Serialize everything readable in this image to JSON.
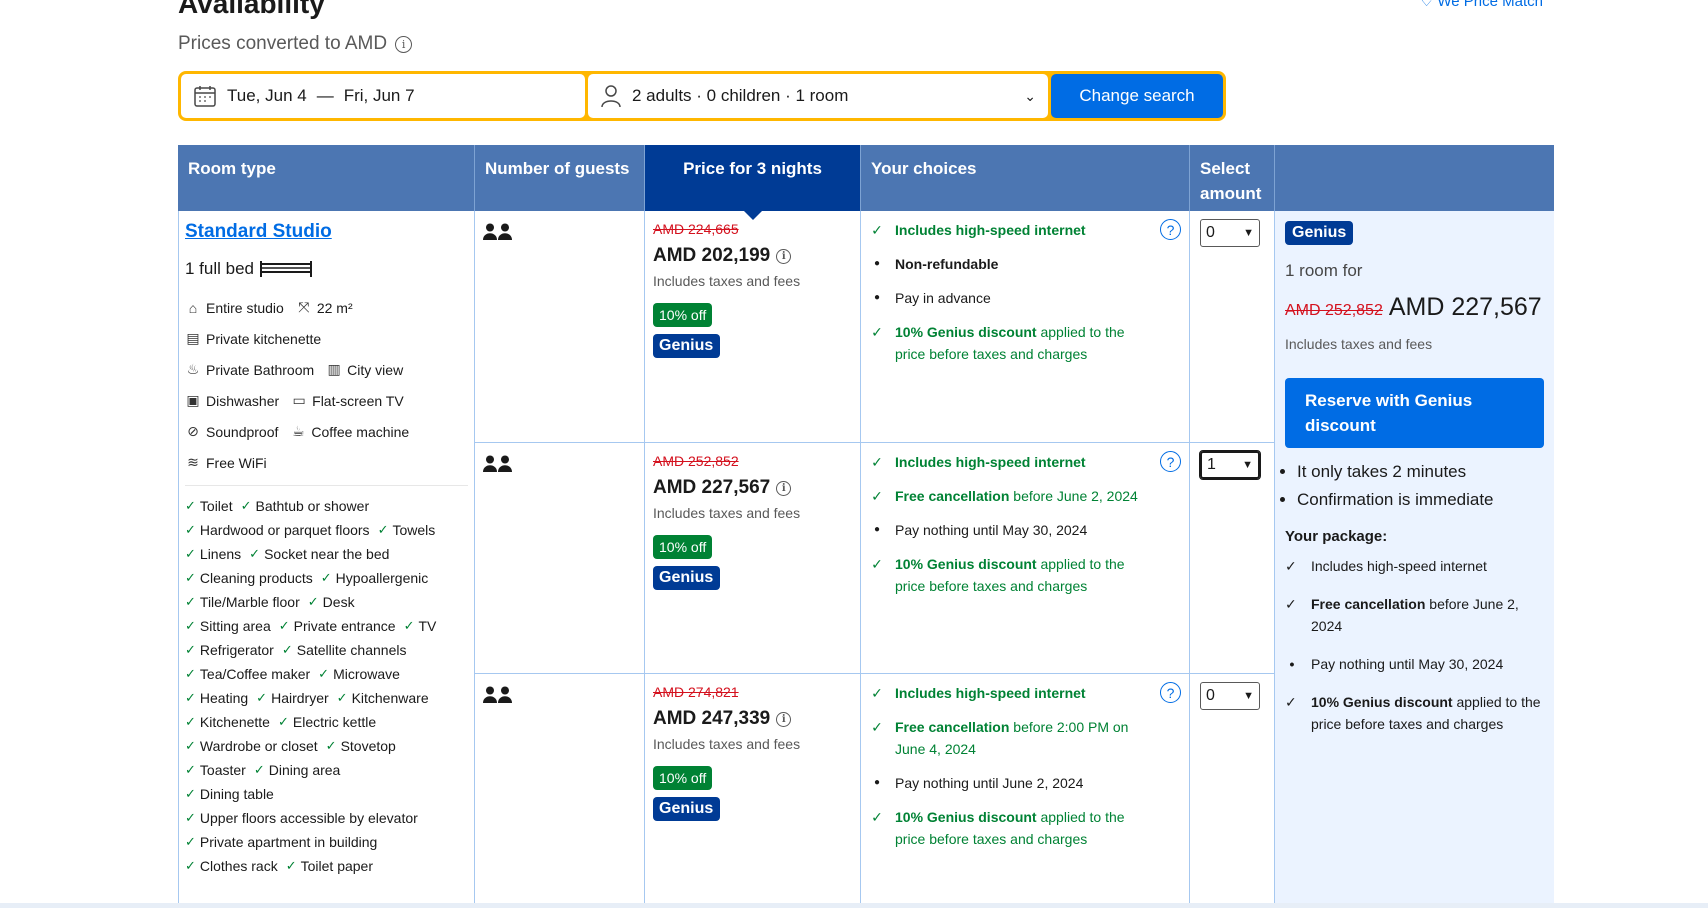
{
  "header": {
    "title": "Availability",
    "subtitle": "Prices converted to AMD",
    "price_match": "We Price Match"
  },
  "search": {
    "date_from": "Tue, Jun 4",
    "date_sep": "—",
    "date_to": "Fri, Jun 7",
    "guests": "2 adults · 0 children · 1 room",
    "button": "Change search"
  },
  "table_headers": {
    "room_type": "Room type",
    "guests": "Number of guests",
    "price": "Price for 3 nights",
    "choices": "Your choices",
    "select_1": "Select",
    "select_2": "amount"
  },
  "room": {
    "name": "Standard Studio",
    "bed": "1 full bed",
    "facilities": [
      [
        "Entire studio",
        "22 m²"
      ],
      [
        "Private kitchenette"
      ],
      [
        "Private Bathroom",
        "City view"
      ],
      [
        "Dishwasher",
        "Flat-screen TV"
      ],
      [
        "Soundproof",
        "Coffee machine"
      ],
      [
        "Free WiFi"
      ]
    ],
    "amenities": [
      [
        "Toilet",
        "Bathtub or shower"
      ],
      [
        "Hardwood or parquet floors",
        "Towels"
      ],
      [
        "Linens",
        "Socket near the bed"
      ],
      [
        "Cleaning products",
        "Hypoallergenic"
      ],
      [
        "Tile/Marble floor",
        "Desk"
      ],
      [
        "Sitting area",
        "Private entrance",
        "TV"
      ],
      [
        "Refrigerator",
        "Satellite channels"
      ],
      [
        "Tea/Coffee maker",
        "Microwave"
      ],
      [
        "Heating",
        "Hairdryer",
        "Kitchenware"
      ],
      [
        "Kitchenette",
        "Electric kettle"
      ],
      [
        "Wardrobe or closet",
        "Stovetop"
      ],
      [
        "Toaster",
        "Dining area"
      ],
      [
        "Dining table"
      ],
      [
        "Upper floors accessible by elevator"
      ],
      [
        "Private apartment in building"
      ],
      [
        "Clothes rack",
        "Toilet paper"
      ]
    ]
  },
  "options": [
    {
      "old_price": "AMD 224,665",
      "price": "AMD 202,199",
      "taxes": "Includes taxes and fees",
      "discount": "10% off",
      "genius": "Genius",
      "choices": [
        {
          "mark": "check",
          "bold": "Includes high-speed internet",
          "rest": "",
          "style": "green"
        },
        {
          "mark": "dot",
          "bold": "Non-refundable",
          "rest": "",
          "style": "dark"
        },
        {
          "mark": "dot",
          "bold": "",
          "rest": "Pay in advance",
          "style": "dark"
        },
        {
          "mark": "check",
          "bold": "10% Genius discount",
          "rest": " applied to the price before taxes and charges",
          "style": "green"
        }
      ],
      "select_value": "0"
    },
    {
      "old_price": "AMD 252,852",
      "price": "AMD 227,567",
      "taxes": "Includes taxes and fees",
      "discount": "10% off",
      "genius": "Genius",
      "choices": [
        {
          "mark": "check",
          "bold": "Includes high-speed internet",
          "rest": "",
          "style": "green"
        },
        {
          "mark": "check",
          "bold": "Free cancellation",
          "rest": " before June 2, 2024",
          "style": "green"
        },
        {
          "mark": "dot",
          "bold": "",
          "rest": "Pay nothing until May 30, 2024",
          "style": "dark"
        },
        {
          "mark": "check",
          "bold": "10% Genius discount",
          "rest": " applied to the price before taxes and charges",
          "style": "green"
        }
      ],
      "select_value": "1"
    },
    {
      "old_price": "AMD 274,821",
      "price": "AMD 247,339",
      "taxes": "Includes taxes and fees",
      "discount": "10% off",
      "genius": "Genius",
      "choices": [
        {
          "mark": "check",
          "bold": "Includes high-speed internet",
          "rest": "",
          "style": "green"
        },
        {
          "mark": "check",
          "bold": "Free cancellation",
          "rest": " before 2:00 PM on June 4, 2024",
          "style": "green"
        },
        {
          "mark": "dot",
          "bold": "",
          "rest": "Pay nothing until June 2, 2024",
          "style": "dark"
        },
        {
          "mark": "check",
          "bold": "10% Genius discount",
          "rest": " applied to the price before taxes and charges",
          "style": "green"
        }
      ],
      "select_value": "0"
    }
  ],
  "summary": {
    "genius": "Genius",
    "room_for": "1 room for",
    "old_price": "AMD 252,852",
    "price": "AMD 227,567",
    "taxes": "Includes taxes and fees",
    "reserve": "Reserve with Genius discount",
    "bullets": [
      "It only takes 2 minutes",
      "Confirmation is immediate"
    ],
    "package_title": "Your package:",
    "package": [
      {
        "mark": "check",
        "bold": "",
        "rest": "Includes high-speed internet"
      },
      {
        "mark": "check",
        "bold": "Free cancellation",
        "rest": " before June 2, 2024"
      },
      {
        "mark": "dot",
        "bold": "",
        "rest": "Pay nothing until May 30, 2024"
      },
      {
        "mark": "check",
        "bold": "10% Genius discount",
        "rest": " applied to the price before taxes and charges"
      }
    ]
  },
  "colors": {
    "header_blue": "#4c76b2",
    "active_blue": "#003b95",
    "brand_blue": "#006ce4",
    "search_yellow": "#ffb700",
    "green": "#008234",
    "strike_red": "#d4111e"
  }
}
